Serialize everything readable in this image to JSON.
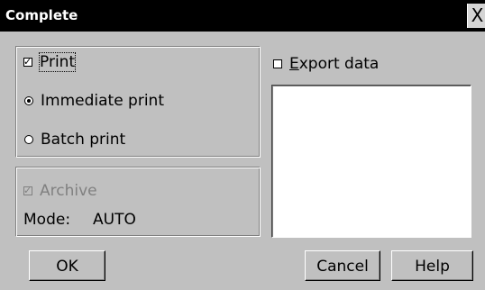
{
  "window": {
    "title": "Complete",
    "close_glyph": "X"
  },
  "print_group": {
    "print_label": "Print",
    "print_checked": true,
    "immediate_label": "Immediate print",
    "batch_label": "Batch print",
    "selected_mode": "Immediate print"
  },
  "archive_group": {
    "archive_label": "Archive",
    "archive_checked": true,
    "archive_enabled": false,
    "mode_label": "Mode:",
    "mode_value": "AUTO"
  },
  "export": {
    "label": "Export data",
    "checked": false
  },
  "buttons": {
    "ok": "OK",
    "cancel": "Cancel",
    "help": "Help"
  }
}
